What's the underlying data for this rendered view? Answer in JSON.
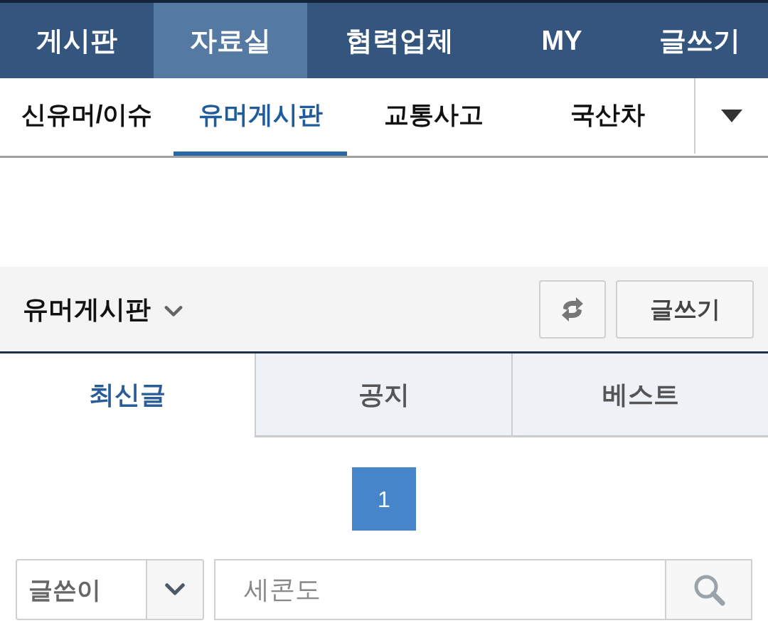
{
  "top_nav": [
    {
      "label": "게시판",
      "selected": false
    },
    {
      "label": "자료실",
      "selected": true
    },
    {
      "label": "협력업체",
      "selected": false
    },
    {
      "label": "MY",
      "selected": false
    },
    {
      "label": "글쓰기",
      "selected": false
    }
  ],
  "sub_nav": [
    {
      "label": "신유머/이슈",
      "selected": false
    },
    {
      "label": "유머게시판",
      "selected": true
    },
    {
      "label": "교통사고",
      "selected": false
    },
    {
      "label": "국산차",
      "selected": false
    }
  ],
  "board_header": {
    "title": "유머게시판",
    "buttons": [
      {
        "kind": "refresh"
      },
      {
        "kind": "text",
        "label": "글쓰기"
      }
    ]
  },
  "tabs": [
    {
      "label": "최신글",
      "selected": true
    },
    {
      "label": "공지",
      "selected": false
    },
    {
      "label": "베스트",
      "selected": false
    }
  ],
  "pagination": [
    {
      "label": "1",
      "selected": true
    }
  ],
  "search": {
    "field": "글쓴이",
    "value": "세콘도"
  }
}
